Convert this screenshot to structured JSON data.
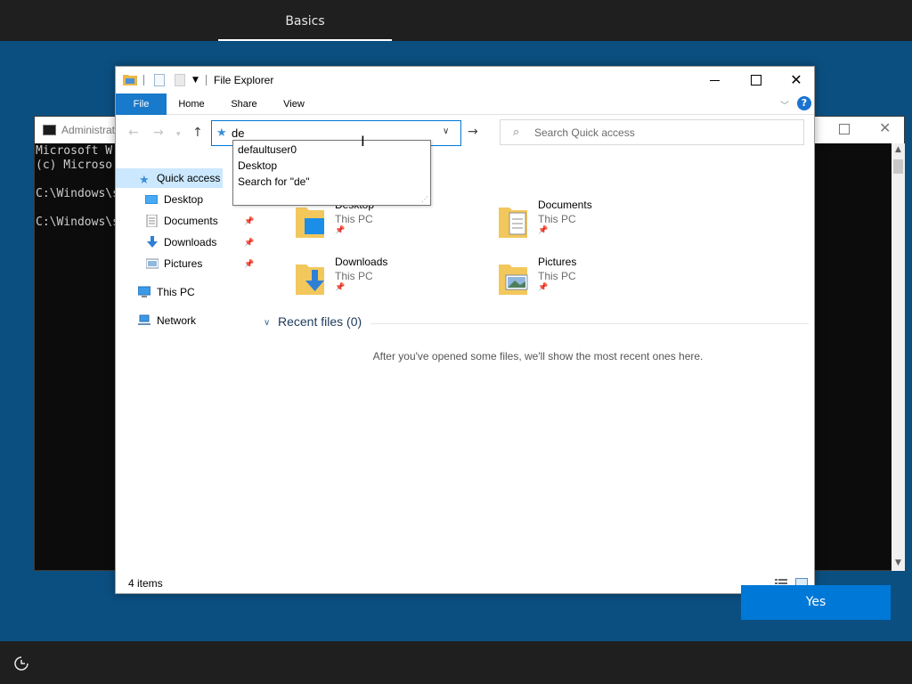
{
  "oobe": {
    "tab_label": "Basics",
    "yes_label": "Yes",
    "accessibility_icon": "accessibility-icon"
  },
  "console": {
    "title": "Administrat",
    "lines": [
      "Microsoft W",
      "(c) Microso",
      "",
      "C:\\Windows\\s",
      "",
      "C:\\Windows\\s"
    ]
  },
  "explorer": {
    "title": "File Explorer",
    "ribbon_tabs": [
      {
        "label": "File",
        "active": true
      },
      {
        "label": "Home"
      },
      {
        "label": "Share"
      },
      {
        "label": "View"
      }
    ],
    "help_label": "?",
    "address": {
      "value": "de"
    },
    "search": {
      "placeholder": "Search Quick access"
    },
    "autocomplete": [
      "defaultuser0",
      "Desktop",
      "Search for \"de\""
    ],
    "nav": {
      "quick_access": "Quick access",
      "items": [
        {
          "label": "Desktop",
          "icon": "desktop-icon",
          "pinned": true
        },
        {
          "label": "Documents",
          "icon": "documents-icon",
          "pinned": true
        },
        {
          "label": "Downloads",
          "icon": "downloads-icon",
          "pinned": true
        },
        {
          "label": "Pictures",
          "icon": "pictures-icon",
          "pinned": true
        }
      ],
      "this_pc": "This PC",
      "network": "Network"
    },
    "tiles": [
      {
        "name": "Desktop",
        "location": "This PC",
        "icon": "desktop-folder-icon"
      },
      {
        "name": "Documents",
        "location": "This PC",
        "icon": "documents-folder-icon"
      },
      {
        "name": "Downloads",
        "location": "This PC",
        "icon": "downloads-folder-icon"
      },
      {
        "name": "Pictures",
        "location": "This PC",
        "icon": "pictures-folder-icon"
      }
    ],
    "recent": {
      "header": "Recent files (0)",
      "empty_message": "After you've opened some files, we'll show the most recent ones here."
    },
    "status": "4 items"
  },
  "colors": {
    "background": "#0b4f80",
    "accent": "#0078d7",
    "ribbon_file": "#1979ca",
    "nav_selected": "#cce8ff"
  }
}
